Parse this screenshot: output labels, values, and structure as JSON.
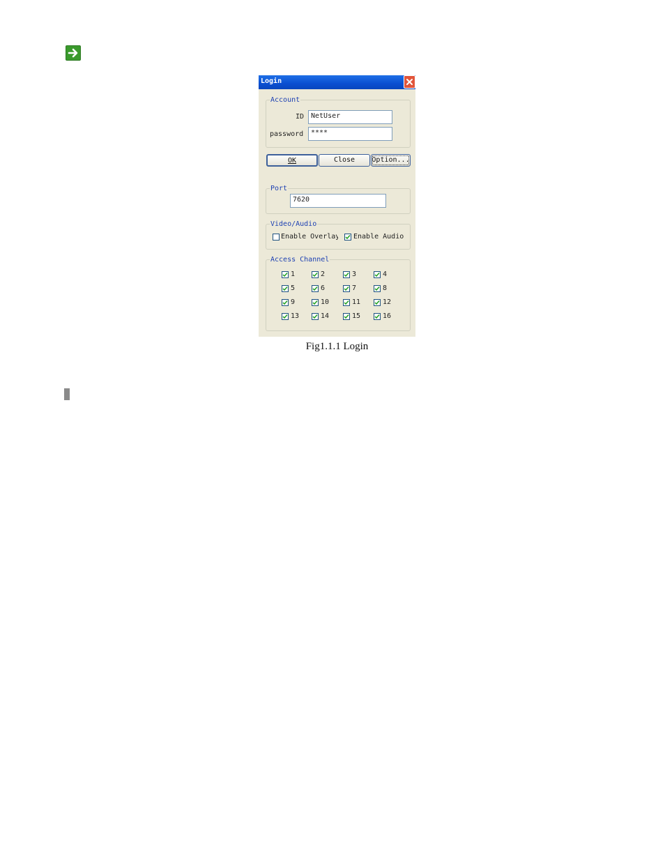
{
  "dialog": {
    "title": "Login",
    "account": {
      "legend": "Account",
      "id_label": "ID",
      "id_value": "NetUser",
      "password_label": "password",
      "password_value": "****"
    },
    "buttons": {
      "ok": "OK",
      "close": "Close",
      "option": "Option..."
    },
    "port": {
      "legend": "Port",
      "value": "7620"
    },
    "video_audio": {
      "legend": "Video/Audio",
      "overlay_label": "Enable Overlay",
      "overlay_checked": false,
      "audio_label": "Enable Audio",
      "audio_checked": true
    },
    "access_channel": {
      "legend": "Access Channel",
      "channels": [
        "1",
        "2",
        "3",
        "4",
        "5",
        "6",
        "7",
        "8",
        "9",
        "10",
        "11",
        "12",
        "13",
        "14",
        "15",
        "16"
      ],
      "all_checked": true
    }
  },
  "caption": "Fig1.1.1 Login"
}
